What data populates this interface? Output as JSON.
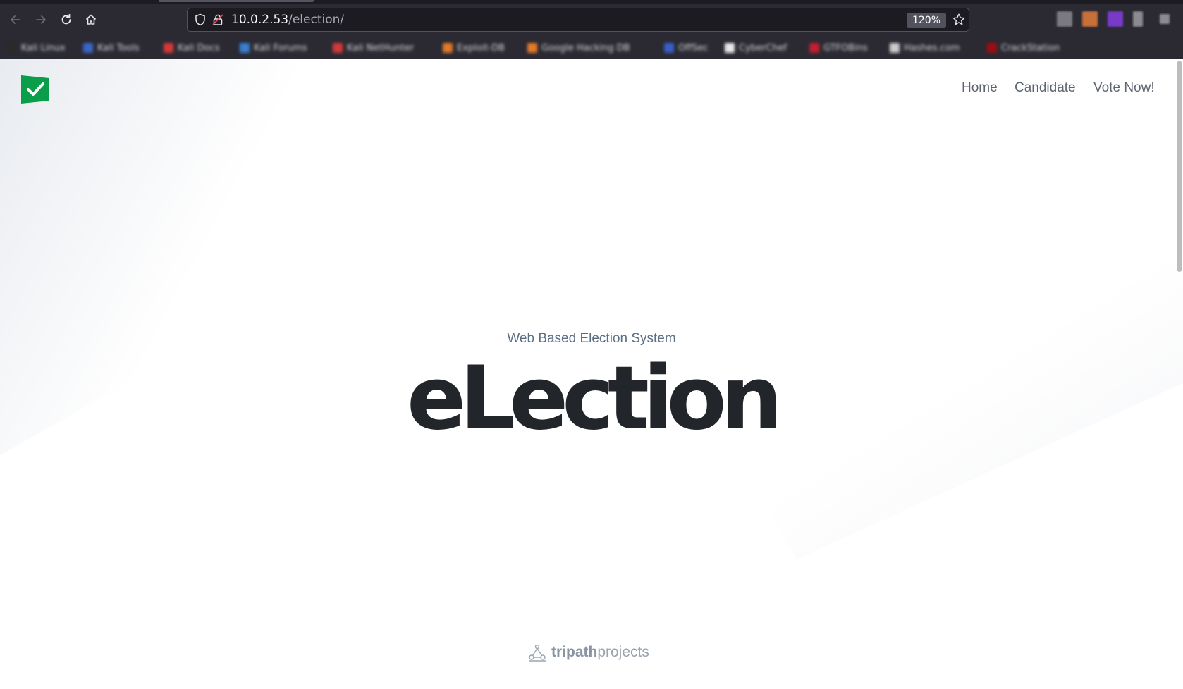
{
  "browser": {
    "url_host": "10.0.2.53",
    "url_path": "/election/",
    "zoom": "120%",
    "bookmarks": [
      {
        "label": "Kali Linux",
        "color": "#2a2a2a"
      },
      {
        "label": "Kali Tools",
        "color": "#3b66c4"
      },
      {
        "label": "Kali Docs",
        "color": "#d03a3a"
      },
      {
        "label": "Kali Forums",
        "color": "#3a7fd0"
      },
      {
        "label": "Kali NetHunter",
        "color": "#d03a3a"
      },
      {
        "label": "Exploit-DB",
        "color": "#e07b2a"
      },
      {
        "label": "Google Hacking DB",
        "color": "#e07b2a"
      },
      {
        "label": "OffSec",
        "color": "#3a5fc4"
      },
      {
        "label": "CyberChef",
        "color": "#e8e8e8"
      },
      {
        "label": "GTFOBins",
        "color": "#c02030"
      },
      {
        "label": "Hashes.com",
        "color": "#cccccc"
      },
      {
        "label": "CrackStation",
        "color": "#9a1010"
      }
    ]
  },
  "nav": {
    "home": "Home",
    "candidate": "Candidate",
    "vote": "Vote Now!"
  },
  "hero": {
    "subtitle": "Web Based Election System",
    "title": "eLection"
  },
  "footer": {
    "brand_bold": "tripath",
    "brand_light": "projects"
  },
  "colors": {
    "logo_green": "#0a9d4a",
    "title": "#22262b",
    "subtitle": "#5a6f86"
  }
}
